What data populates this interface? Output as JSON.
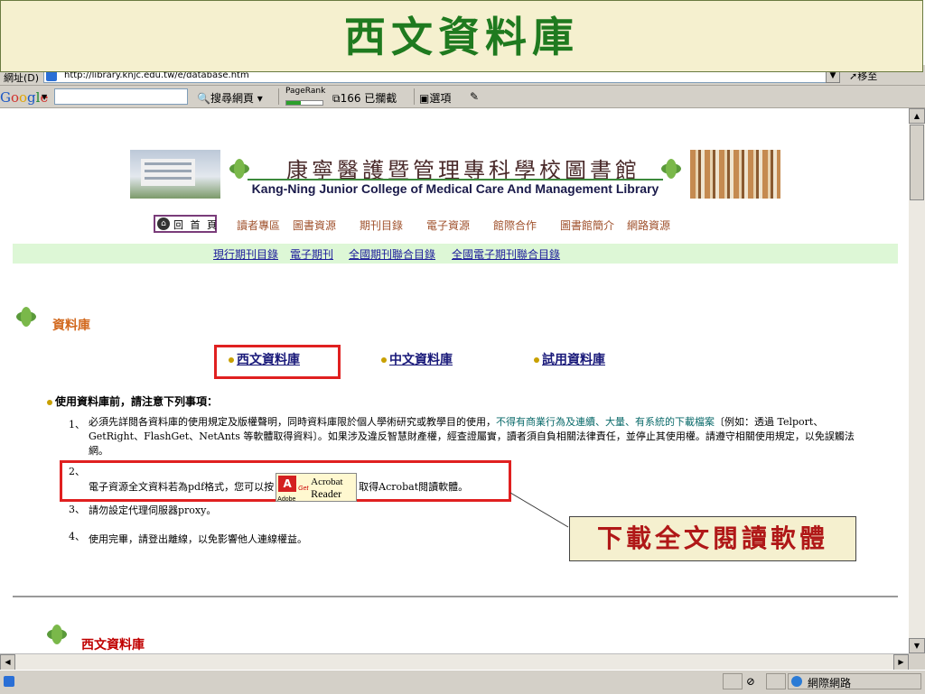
{
  "slide_title": "西文資料庫",
  "browser": {
    "address_label": "網址(D)",
    "url": "http://library.knjc.edu.tw/e/database.htm",
    "go_label": "移至"
  },
  "google_bar": {
    "logo": "Google",
    "search_web": "搜尋網頁",
    "pagerank": "PageRank",
    "blocked": "166 已攔截",
    "options": "選項"
  },
  "site_header": {
    "title_cn": "康寧醫護暨管理專科學校圖書館",
    "title_en": "Kang-Ning Junior College of Medical Care And Management Library"
  },
  "nav": {
    "home": "回 首 頁",
    "items": [
      "讀者專區",
      "圖書資源",
      "期刊目錄",
      "電子資源",
      "館際合作",
      "圖書館簡介",
      "網路資源"
    ]
  },
  "subnav": [
    "現行期刊目錄",
    "電子期刊",
    "全國期刊聯合目錄",
    "全國電子期刊聯合目錄"
  ],
  "section1_title": "資料庫",
  "tabs": [
    "西文資料庫",
    "中文資料庫",
    "試用資料庫"
  ],
  "notice": {
    "title": "使用資料庫前，請注意下列事項：",
    "items": [
      {
        "num": "1、",
        "text_a": "必須先詳閱各資料庫的使用規定及版權聲明，同時資料庫限於個人學術研究或教學目的使用，",
        "text_green": "不得有商業行為及連續、大量、有系統的下載檔案",
        "text_b": "〔例如：透過 Telport、GetRight、FlashGet、NetAnts 等軟體取得資料〕。如果涉及違反智慧財產權，經查證屬實，讀者須自負相關法律責任，並停止其使用權。請遵守相關使用規定，以免誤觸法網。"
      },
      {
        "num": "2、",
        "text_a": "電子資源全文資料若為pdf格式，您可以按",
        "text_b": "取得Acrobat閱讀軟體。"
      },
      {
        "num": "3、",
        "text": "請勿設定代理伺服器proxy。"
      },
      {
        "num": "4、",
        "text": "使用完畢，請登出離線，以免影響他人連線權益。"
      }
    ]
  },
  "acrobat_badge": {
    "logo": "A",
    "adobe": "Adobe",
    "get": "Get",
    "name": "Acrobat",
    "reader": "Reader"
  },
  "callout": "下載全文閱讀軟體",
  "section2_title": "西文資料庫",
  "status_bar": {
    "zone": "網際網路"
  },
  "colors": {
    "banner_title": "#1f7a1f",
    "highlight_box": "#e02020",
    "callout_text": "#b01818",
    "subnav_bg": "#ddf7d6"
  }
}
